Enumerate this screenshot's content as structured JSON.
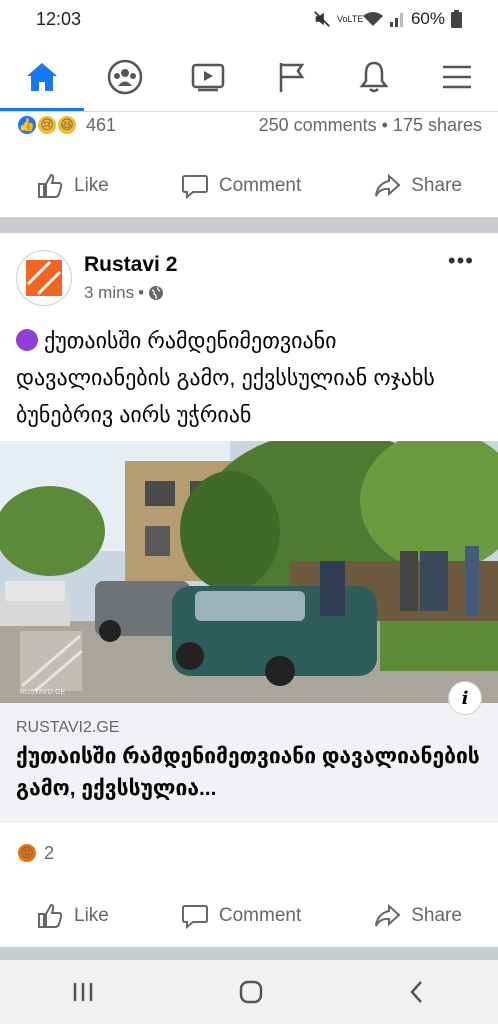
{
  "status": {
    "time": "12:03",
    "signal_label": "VoLTE",
    "battery": "60%"
  },
  "nav": {
    "items": [
      {
        "icon": "home-icon",
        "active": true
      },
      {
        "icon": "groups-icon"
      },
      {
        "icon": "video-icon"
      },
      {
        "icon": "pages-flag-icon"
      },
      {
        "icon": "notifications-bell-icon"
      },
      {
        "icon": "menu-icon"
      }
    ]
  },
  "prev_post": {
    "reaction_count": "461",
    "comments_shares": "250 comments • 175 shares"
  },
  "actions": {
    "like": "Like",
    "comment": "Comment",
    "share": "Share"
  },
  "post": {
    "author": "Rustavi 2",
    "time": "3 mins",
    "separator": "•",
    "text": "ქუთაისში რამდენიმეთვიანი დავალიანების გამო, ექვსსულიან ოჯახს ბუნებრივ აირს უჭრიან",
    "photo_watermark": "RUSTAVI2.GE",
    "link_domain": "RUSTAVI2.GE",
    "link_title": "ქუთაისში რამდენიმეთვიანი დავალიანების გამო, ექვსსულია...",
    "info_label": "i",
    "reaction_count": "2"
  },
  "colors": {
    "accent": "#1877f2",
    "muted": "#65676b",
    "divider": "#c9ccd1"
  }
}
